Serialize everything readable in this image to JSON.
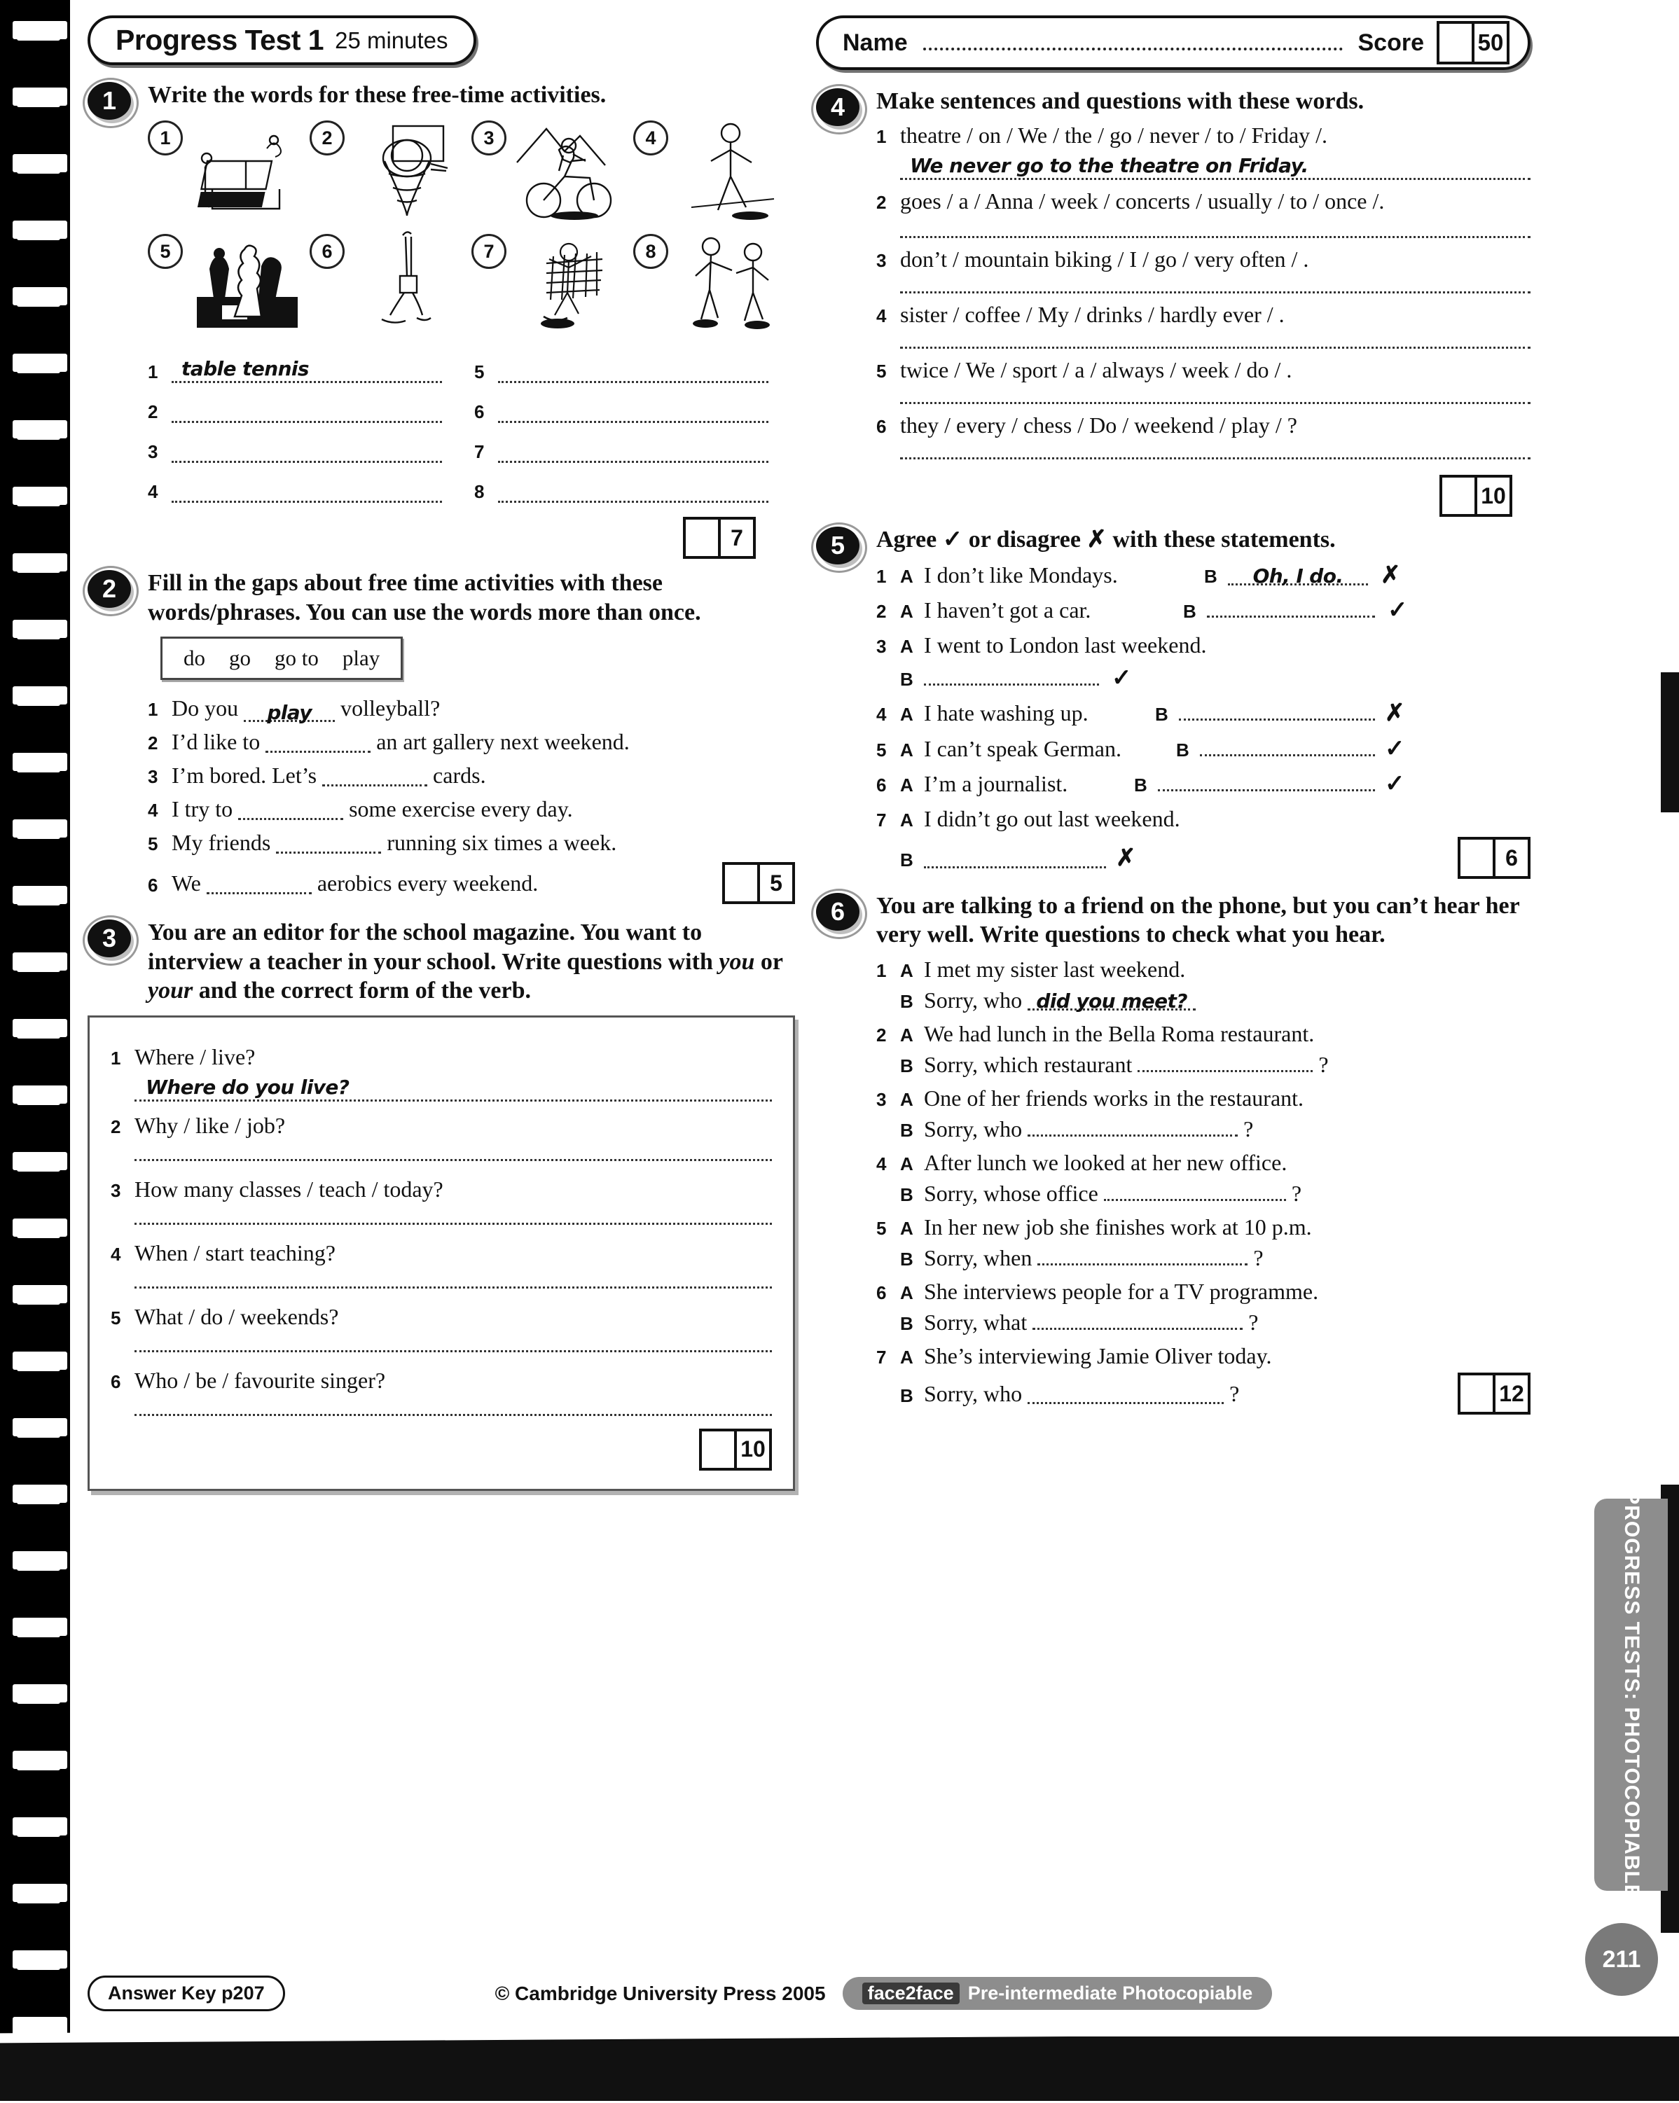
{
  "header": {
    "title": "Progress Test 1",
    "duration": "25 minutes",
    "name_label": "Name",
    "name_value": "",
    "score_label": "Score",
    "score_value": "",
    "score_total": "50"
  },
  "exercises": [
    {
      "number": "1",
      "instruction": "Write the words for these free-time activities.",
      "pictures": [
        {
          "n": "1",
          "icon": "table-tennis-icon"
        },
        {
          "n": "2",
          "icon": "basketball-icon"
        },
        {
          "n": "3",
          "icon": "mountain-biking-icon"
        },
        {
          "n": "4",
          "icon": "walking-icon"
        },
        {
          "n": "5",
          "icon": "chess-icon"
        },
        {
          "n": "6",
          "icon": "yoga-handstand-icon"
        },
        {
          "n": "7",
          "icon": "skateboarding-icon"
        },
        {
          "n": "8",
          "icon": "martial-arts-icon"
        }
      ],
      "answers": [
        {
          "n": "1",
          "value": "table tennis"
        },
        {
          "n": "2",
          "value": ""
        },
        {
          "n": "3",
          "value": ""
        },
        {
          "n": "4",
          "value": ""
        },
        {
          "n": "5",
          "value": ""
        },
        {
          "n": "6",
          "value": ""
        },
        {
          "n": "7",
          "value": ""
        },
        {
          "n": "8",
          "value": ""
        }
      ],
      "marks": "7"
    },
    {
      "number": "2",
      "instruction": "Fill in the gaps about free time activities with these words/phrases. You can use the words more than once.",
      "wordbank": [
        "do",
        "go",
        "go to",
        "play"
      ],
      "items": [
        {
          "n": "1",
          "before": "Do you",
          "answer": "play",
          "after": "volleyball?"
        },
        {
          "n": "2",
          "before": "I’d like to",
          "answer": "",
          "after": "an art gallery next weekend."
        },
        {
          "n": "3",
          "before": "I’m bored. Let’s",
          "answer": "",
          "after": "cards."
        },
        {
          "n": "4",
          "before": "I try to",
          "answer": "",
          "after": "some exercise every day."
        },
        {
          "n": "5",
          "before": "My friends",
          "answer": "",
          "after": "running six times a week."
        },
        {
          "n": "6",
          "before": "We",
          "answer": "",
          "after": "aerobics every weekend."
        }
      ],
      "marks": "5"
    },
    {
      "number": "3",
      "instruction_parts": [
        {
          "t": "You are an editor for the school magazine. You want to interview a teacher in your school. Write questions with ",
          "i": false
        },
        {
          "t": "you",
          "i": true
        },
        {
          "t": " or ",
          "i": false
        },
        {
          "t": "your",
          "i": true
        },
        {
          "t": " and the correct form of the verb.",
          "i": false
        }
      ],
      "items": [
        {
          "n": "1",
          "prompt": "Where / live?",
          "answer": "Where do you live?"
        },
        {
          "n": "2",
          "prompt": "Why / like / job?",
          "answer": ""
        },
        {
          "n": "3",
          "prompt": "How many classes / teach / today?",
          "answer": ""
        },
        {
          "n": "4",
          "prompt": "When / start teaching?",
          "answer": ""
        },
        {
          "n": "5",
          "prompt": "What / do / weekends?",
          "answer": ""
        },
        {
          "n": "6",
          "prompt": "Who / be / favourite singer?",
          "answer": ""
        }
      ],
      "marks": "10"
    },
    {
      "number": "4",
      "instruction": "Make sentences and questions with these words.",
      "items": [
        {
          "n": "1",
          "prompt": "theatre / on / We / the / go / never / to / Friday /.",
          "answer": "We never go to the theatre on Friday."
        },
        {
          "n": "2",
          "prompt": "goes / a / Anna / week / concerts / usually / to / once /.",
          "answer": ""
        },
        {
          "n": "3",
          "prompt": "don’t / mountain biking / I / go / very often / .",
          "answer": ""
        },
        {
          "n": "4",
          "prompt": "sister / coffee / My / drinks / hardly ever / .",
          "answer": ""
        },
        {
          "n": "5",
          "prompt": "twice / We / sport / a / always / week / do / .",
          "answer": ""
        },
        {
          "n": "6",
          "prompt": "they / every / chess / Do / weekend / play / ?",
          "answer": ""
        }
      ],
      "marks": "10"
    },
    {
      "number": "5",
      "instruction": "Agree ✓ or disagree ✗ with these statements.",
      "items": [
        {
          "n": "1",
          "a": "I don’t like Mondays.",
          "b_label": "B",
          "b_answer": "Oh, I do.",
          "mark": "✗",
          "wrap": false
        },
        {
          "n": "2",
          "a": "I haven’t got a car.",
          "b_label": "B",
          "b_answer": "",
          "mark": "✓",
          "wrap": false
        },
        {
          "n": "3",
          "a": "I went to London last weekend.",
          "b_label": "B",
          "b_answer": "",
          "mark": "✓",
          "wrap": true
        },
        {
          "n": "4",
          "a": "I hate washing up.",
          "b_label": "B",
          "b_answer": "",
          "mark": "✗",
          "wrap": false
        },
        {
          "n": "5",
          "a": "I can’t speak German.",
          "b_label": "B",
          "b_answer": "",
          "mark": "✓",
          "wrap": false
        },
        {
          "n": "6",
          "a": "I’m a journalist.",
          "b_label": "B",
          "b_answer": "",
          "mark": "✓",
          "wrap": false
        },
        {
          "n": "7",
          "a": "I didn’t go out last weekend.",
          "b_label": "B",
          "b_answer": "",
          "mark": "✗",
          "wrap": true
        }
      ],
      "marks": "6"
    },
    {
      "number": "6",
      "instruction": "You are talking to a friend on the phone, but you can’t hear her very well. Write questions to check what you hear.",
      "items": [
        {
          "n": "1",
          "a": "I met my sister last weekend.",
          "b_before": "Sorry, who",
          "b_answer": "did you meet?",
          "b_after": ""
        },
        {
          "n": "2",
          "a": "We had lunch in the Bella Roma restaurant.",
          "a_italic": "Bella Roma",
          "b_before": "Sorry, which restaurant",
          "b_answer": "",
          "b_after": "?"
        },
        {
          "n": "3",
          "a": "One of her friends works in the restaurant.",
          "b_before": "Sorry, who",
          "b_answer": "",
          "b_after": "?"
        },
        {
          "n": "4",
          "a": "After lunch we looked at her new office.",
          "b_before": "Sorry, whose office",
          "b_answer": "",
          "b_after": "?"
        },
        {
          "n": "5",
          "a": "In her new job she finishes work at 10 p.m.",
          "b_before": "Sorry, when",
          "b_answer": "",
          "b_after": "?"
        },
        {
          "n": "6",
          "a": "She interviews people for a TV programme.",
          "b_before": "Sorry, what",
          "b_answer": "",
          "b_after": "?"
        },
        {
          "n": "7",
          "a": "She’s interviewing Jamie Oliver today.",
          "b_before": "Sorry, who",
          "b_answer": "",
          "b_after": "?"
        }
      ],
      "marks": "12"
    }
  ],
  "footer": {
    "answer_key": "Answer Key p207",
    "copyright": "© Cambridge University Press 2005",
    "brand": "face2face",
    "brand_rest": "Pre-intermediate Photocopiable"
  },
  "side_tab": {
    "label": "PROGRESS TESTS: PHOTOCOPIABLE",
    "page": "211"
  }
}
